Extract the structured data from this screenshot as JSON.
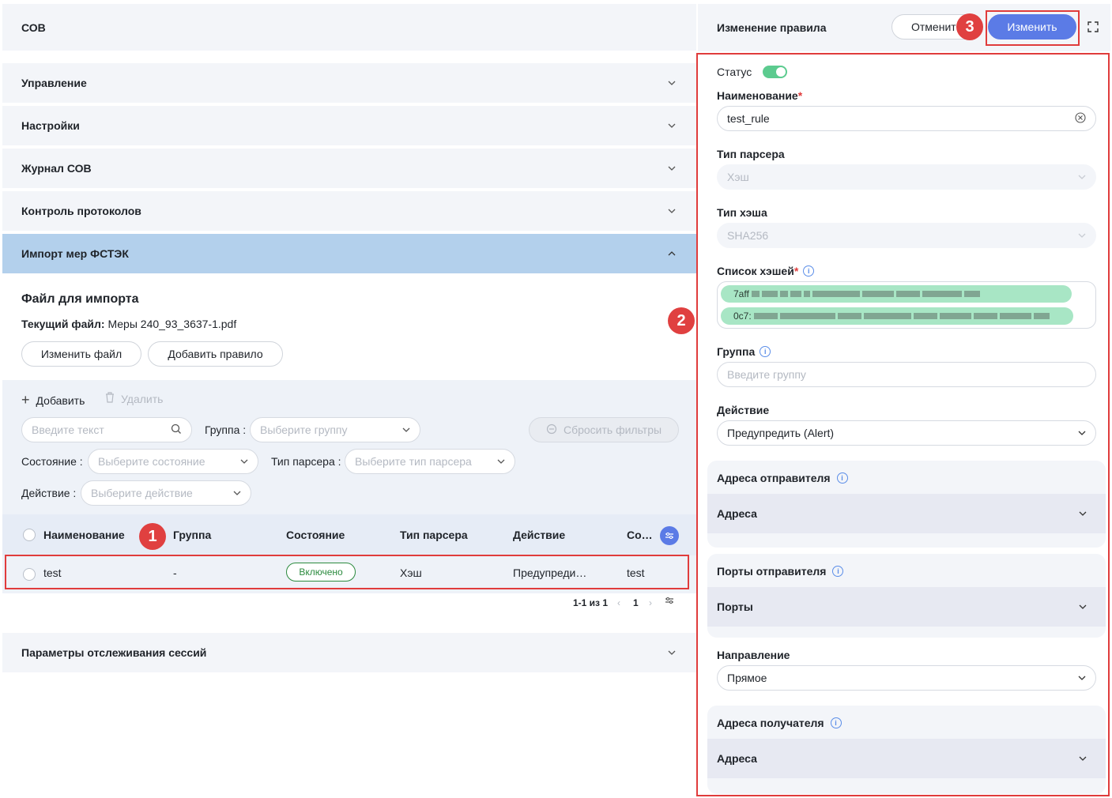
{
  "left": {
    "header_title": "СОВ",
    "accordion": [
      {
        "label": "Управление"
      },
      {
        "label": "Настройки"
      },
      {
        "label": "Журнал СОВ"
      },
      {
        "label": "Контроль протоколов"
      },
      {
        "label": "Импорт мер ФСТЭК"
      }
    ],
    "import": {
      "title": "Файл для импорта",
      "current_label": "Текущий файл:",
      "current_file": "Меры 240_93_3637-1.pdf",
      "change_file": "Изменить файл",
      "add_rule": "Добавить правило"
    },
    "toolbar": {
      "add": "Добавить",
      "delete": "Удалить",
      "search_placeholder": "Введите текст",
      "group_label": "Группа :",
      "group_placeholder": "Выберите группу",
      "reset": "Сбросить фильтры",
      "state_label": "Состояние :",
      "state_placeholder": "Выберите состояние",
      "parser_label": "Тип парсера :",
      "parser_placeholder": "Выберите тип парсера",
      "action_label": "Действие :",
      "action_placeholder": "Выберите действие"
    },
    "table": {
      "columns": [
        "Наименование",
        "Группа",
        "Состояние",
        "Тип парсера",
        "Действие",
        "Со…"
      ],
      "rows": [
        {
          "name": "test",
          "group": "-",
          "state": "Включено",
          "parser": "Хэш",
          "action": "Предупреди…",
          "extra": "test"
        }
      ]
    },
    "pagination": {
      "range": "1-1 из 1",
      "page": "1"
    },
    "sessions": "Параметры отслеживания сессий"
  },
  "right": {
    "title": "Изменение правила",
    "cancel": "Отменит",
    "submit": "Изменить",
    "status_label": "Статус",
    "name_label": "Наименование",
    "name_value": "test_rule",
    "parser_label": "Тип парсера",
    "parser_value": "Хэш",
    "hash_label": "Тип хэша",
    "hash_value": "SHA256",
    "hashlist_label": "Список хэшей",
    "hashes": [
      "7aff",
      "0c7:"
    ],
    "group_label": "Группа",
    "group_placeholder": "Введите группу",
    "action_label": "Действие",
    "action_value": "Предупредить (Alert)",
    "sender_addr_label": "Адреса отправителя",
    "sender_addr_body": "Адреса",
    "sender_ports_label": "Порты отправителя",
    "sender_ports_body": "Порты",
    "direction_label": "Направление",
    "direction_value": "Прямое",
    "recv_addr_label": "Адреса получателя",
    "recv_addr_body": "Адреса"
  },
  "markers": [
    "1",
    "2",
    "3"
  ],
  "colors": {
    "accent": "#5b7be6",
    "annotation": "#e03c3c",
    "toggle": "#5ccb8f"
  }
}
